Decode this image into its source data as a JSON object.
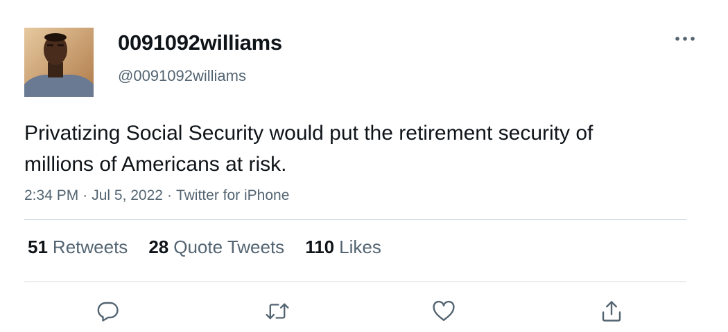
{
  "user": {
    "display_name": "0091092williams",
    "handle": "@0091092williams",
    "avatar_icon": "user-avatar-photo"
  },
  "tweet": {
    "text": "Privatizing Social Security would put the retirement security of millions of Americans at risk.",
    "time": "2:34 PM",
    "date": "Jul 5, 2022",
    "source": "Twitter for iPhone",
    "separator": "·"
  },
  "stats": {
    "retweets": {
      "count": "51",
      "label": "Retweets"
    },
    "quote_tweets": {
      "count": "28",
      "label": "Quote Tweets"
    },
    "likes": {
      "count": "110",
      "label": "Likes"
    }
  },
  "actions": {
    "reply_icon": "reply-icon",
    "retweet_icon": "retweet-icon",
    "like_icon": "heart-icon",
    "share_icon": "share-icon",
    "more_icon": "more-icon"
  },
  "colors": {
    "text_primary": "#0f1419",
    "text_secondary": "#536471",
    "divider": "#cfd9de",
    "icon": "#536471"
  }
}
